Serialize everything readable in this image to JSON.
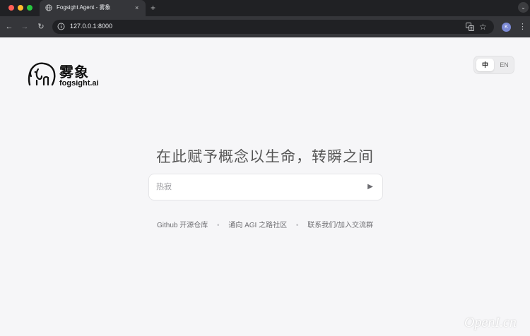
{
  "browser": {
    "tab_title": "Fogsight Agent - 雾象",
    "tab_close": "×",
    "new_tab": "+",
    "tab_menu": "⌄",
    "url": "127.0.0.1:8000",
    "avatar_letter": "K",
    "nav_back": "←",
    "nav_forward": "→",
    "nav_reload": "↻",
    "star": "☆",
    "kebab": "⋮"
  },
  "logo": {
    "name_cn": "雾象",
    "name_en": "fogsight.ai"
  },
  "lang": {
    "zh": "中",
    "en": "EN"
  },
  "hero": {
    "headline": "在此赋予概念以生命，转瞬之间"
  },
  "prompt": {
    "placeholder": "热寂",
    "send": "▶"
  },
  "links": {
    "github": "Github 开源仓库",
    "agi": "通向 AGI 之路社区",
    "contact": "联系我们/加入交流群",
    "separator": "•"
  },
  "watermark": "OpenI.cn"
}
